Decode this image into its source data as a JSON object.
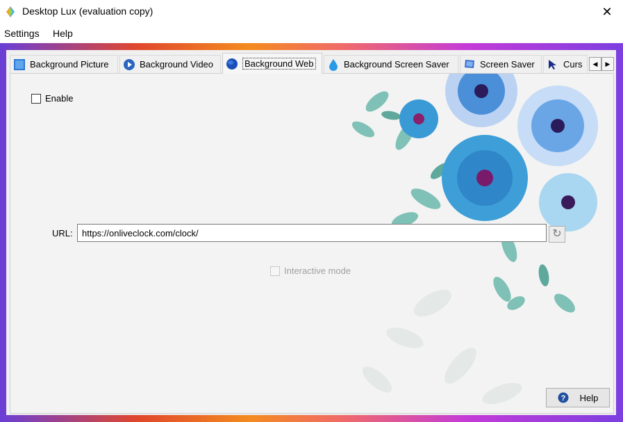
{
  "window": {
    "title": "Desktop Lux (evaluation copy)",
    "close_glyph": "✕"
  },
  "menu": {
    "items": [
      "Settings",
      "Help"
    ]
  },
  "tabs": [
    {
      "label": "Background Picture",
      "icon": "picture-icon",
      "active": false
    },
    {
      "label": "Background Video",
      "icon": "video-play-icon",
      "active": false
    },
    {
      "label": "Background Web",
      "icon": "globe-icon",
      "active": true
    },
    {
      "label": "Background Screen Saver",
      "icon": "droplet-icon",
      "active": false
    },
    {
      "label": "Screen Saver",
      "icon": "monitor-icon",
      "active": false
    },
    {
      "label": "Curs",
      "icon": "cursor-icon",
      "active": false
    }
  ],
  "tab_scroll": {
    "left": "◀",
    "right": "▶"
  },
  "content": {
    "enable_label": "Enable",
    "enable_checked": false,
    "url_label": "URL:",
    "url_value": "https://onliveclock.com/clock/",
    "interactive_label": "Interactive mode",
    "interactive_enabled": false,
    "help_label": "Help"
  },
  "colors": {
    "accent": "#1e6fd9",
    "flower_blue": "#3aa0d8",
    "leaf_teal": "#6fb3a8"
  }
}
